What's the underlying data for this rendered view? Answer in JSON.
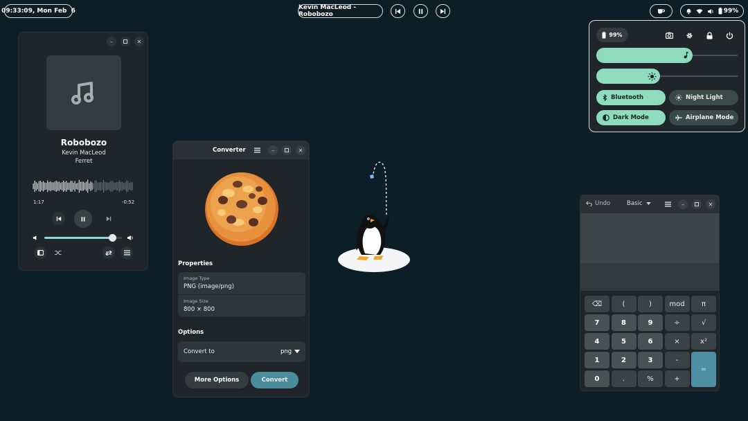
{
  "topbar": {
    "clock": "09:33:09, Mon Feb  6",
    "now_playing": "Kevin MacLeod - Robobozo",
    "battery": "99%"
  },
  "music_player": {
    "title": "Robobozo",
    "artist": "Kevin MacLeod",
    "album": "Ferret",
    "elapsed": "1:17",
    "remaining": "-0:52",
    "progress": 0.6,
    "volume": 0.88
  },
  "converter": {
    "title": "Converter",
    "properties_label": "Properties",
    "image_type_caption": "Image Type",
    "image_type_value": "PNG (image/png)",
    "image_size_caption": "Image Size",
    "image_size_value": "800 × 800",
    "options_label": "Options",
    "convert_to_label": "Convert to",
    "convert_to_value": "png",
    "more_options_label": "More Options",
    "convert_label": "Convert"
  },
  "quick_settings": {
    "battery": "99%",
    "volume_level": 0.68,
    "brightness_level": 0.45,
    "toggles": [
      {
        "label": "Bluetooth",
        "on": true
      },
      {
        "label": "Night Light",
        "on": false
      },
      {
        "label": "Dark Mode",
        "on": true
      },
      {
        "label": "Airplane Mode",
        "on": false
      }
    ]
  },
  "calculator": {
    "undo_label": "Undo",
    "mode_label": "Basic",
    "keys": [
      [
        "⌫",
        "(",
        ")",
        "mod",
        "π"
      ],
      [
        "7",
        "8",
        "9",
        "÷",
        "√"
      ],
      [
        "4",
        "5",
        "6",
        "×",
        "x²"
      ],
      [
        "1",
        "2",
        "3",
        "-",
        "="
      ],
      [
        "0",
        ".",
        "%",
        "+"
      ]
    ]
  },
  "colors": {
    "desktop_bg": "#0c1e28",
    "accent_green": "#8edcbd",
    "accent_blue": "#4f8fa3",
    "convert_button": "#4d8c9b"
  }
}
